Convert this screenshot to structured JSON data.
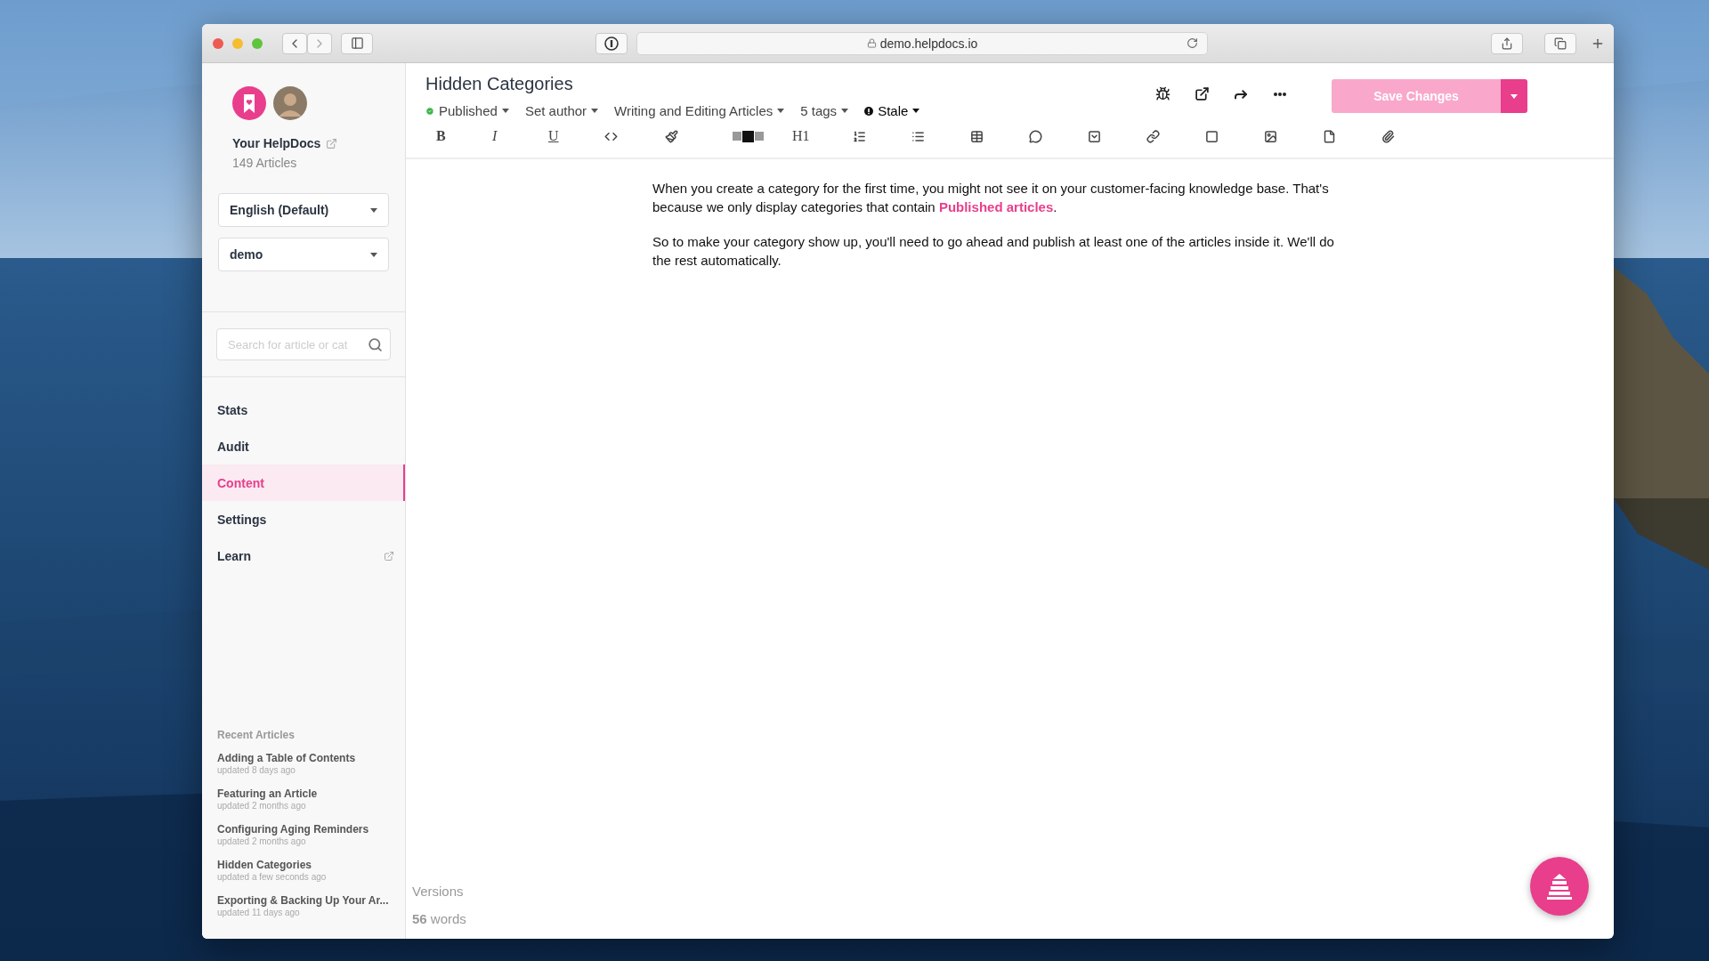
{
  "browser": {
    "url": "demo.helpdocs.io"
  },
  "sidebar": {
    "site_name": "Your HelpDocs",
    "article_count": "149 Articles",
    "language": "English (Default)",
    "workspace": "demo",
    "search": {
      "placeholder": "Search for article or cat"
    },
    "nav": [
      {
        "label": "Stats",
        "selected": false,
        "external": false
      },
      {
        "label": "Audit",
        "selected": false,
        "external": false
      },
      {
        "label": "Content",
        "selected": true,
        "external": false
      },
      {
        "label": "Settings",
        "selected": false,
        "external": false
      },
      {
        "label": "Learn",
        "selected": false,
        "external": true
      }
    ],
    "recent": {
      "heading": "Recent Articles",
      "items": [
        {
          "title": "Adding a Table of Contents",
          "updated": "updated 8 days ago"
        },
        {
          "title": "Featuring an Article",
          "updated": "updated 2 months ago"
        },
        {
          "title": "Configuring Aging Reminders",
          "updated": "updated 2 months ago"
        },
        {
          "title": "Hidden Categories",
          "updated": "updated a few seconds ago"
        },
        {
          "title": "Exporting & Backing Up Your Ar...",
          "updated": "updated 11 days ago"
        }
      ]
    }
  },
  "article": {
    "title": "Hidden Categories",
    "meta": [
      {
        "kind": "status",
        "label": "Published"
      },
      {
        "kind": "dropdown",
        "label": "Set author"
      },
      {
        "kind": "dropdown",
        "label": "Writing and Editing Articles"
      },
      {
        "kind": "dropdown",
        "label": "5 tags"
      },
      {
        "kind": "stale",
        "label": "Stale"
      }
    ],
    "save": {
      "label": "Save Changes",
      "disabled": true
    },
    "format_toolbar": {
      "bold": "B",
      "italic": "I",
      "underline": "U",
      "heading": "H1"
    },
    "paragraphs": [
      "When you create a category for the first time, you might not see it on your customer-facing knowledge base. That's because we only display categories that contain **Published articles**.",
      "So to make your category show up, you'll need to go ahead and publish at least one of the articles inside it. We'll do the rest automatically."
    ],
    "versions": "Versions",
    "word_count": "**56** words"
  }
}
